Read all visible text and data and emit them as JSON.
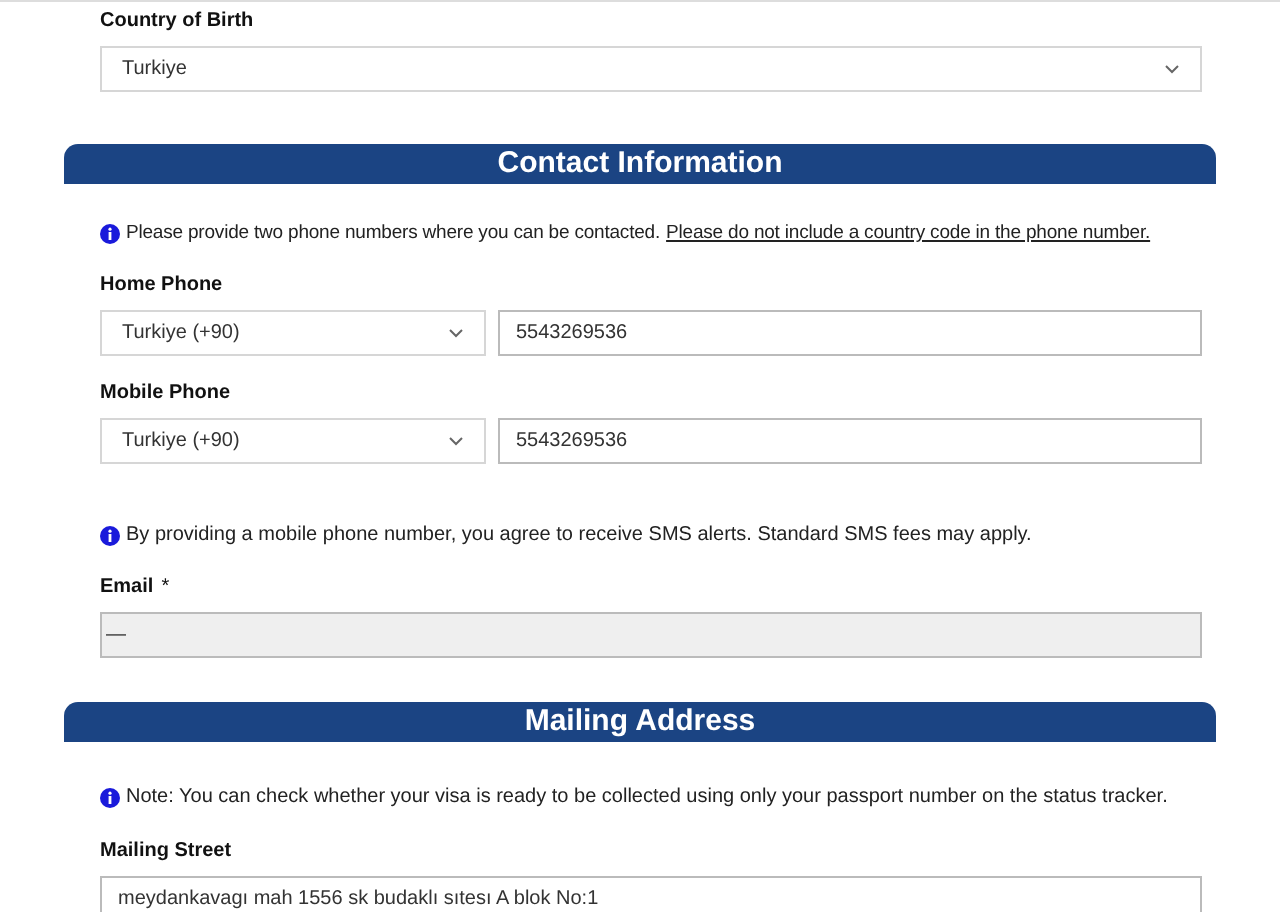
{
  "country_of_birth": {
    "label": "Country of Birth",
    "value": "Turkiye"
  },
  "contact_section": {
    "title": "Contact Information",
    "info": {
      "text": "Please provide two phone numbers where you can be contacted.",
      "link": "Please do not include a country code in the phone number."
    },
    "phones": [
      {
        "label": "Home Phone",
        "country": "Turkiye (+90)",
        "number": "5543269536"
      },
      {
        "label": "Mobile Phone",
        "country": "Turkiye (+90)",
        "number": "5543269536"
      }
    ],
    "sms_info": "By providing a mobile phone number, you agree to receive SMS alerts. Standard SMS fees may apply.",
    "email": {
      "label": "Email",
      "required_mark": "*",
      "value": "—",
      "disabled": true
    }
  },
  "mailing_section": {
    "title": "Mailing Address",
    "note": "Note: You can check whether your visa is ready to be collected using only your passport number on the status tracker.",
    "street": {
      "label": "Mailing Street",
      "value": "meydankavagı mah 1556 sk budaklı sıtesı A blok No:1"
    }
  }
}
